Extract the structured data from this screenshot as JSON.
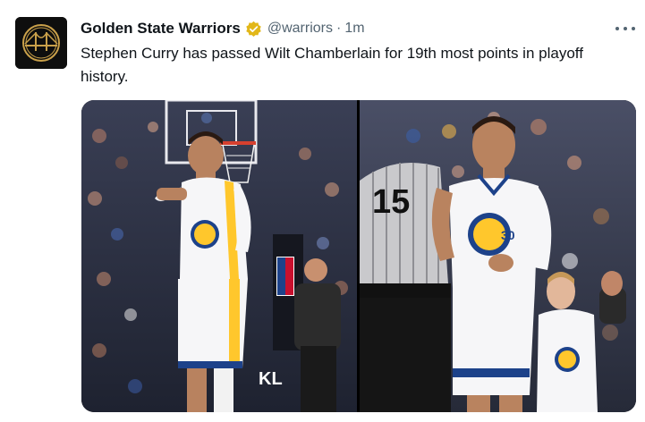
{
  "account": {
    "display_name": "Golden State Warriors",
    "handle": "@warriors",
    "separator": "·",
    "time": "1m",
    "verified_badge": "gold-verified-icon",
    "avatar_icon": "golden-gate-bridge-logo"
  },
  "menu": {
    "icon": "more-horizontal-icon"
  },
  "tweet": {
    "text": "Stephen Curry has passed Wilt Chamberlain for 19th most points in playoff history."
  },
  "media": {
    "photos": [
      {
        "description_icon": "player-clapping-photo"
      },
      {
        "description_icon": "player-smiling-photo",
        "referee_number": "15",
        "jersey_number": "30"
      }
    ]
  },
  "colors": {
    "warriors_blue": "#1d428a",
    "warriors_gold": "#ffc72c",
    "handle_gray": "#536471",
    "verified_gold": "#e2b719"
  }
}
